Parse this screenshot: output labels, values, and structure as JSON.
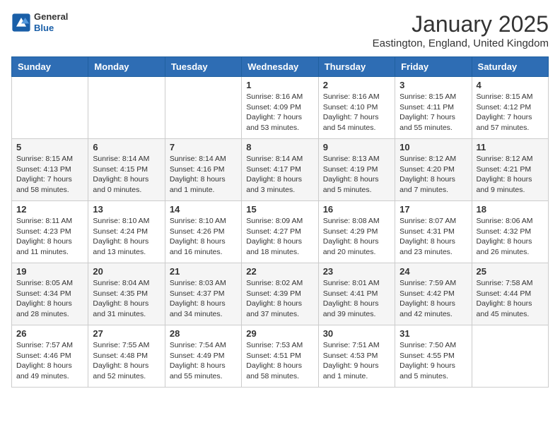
{
  "header": {
    "logo_general": "General",
    "logo_blue": "Blue",
    "month": "January 2025",
    "location": "Eastington, England, United Kingdom"
  },
  "days_of_week": [
    "Sunday",
    "Monday",
    "Tuesday",
    "Wednesday",
    "Thursday",
    "Friday",
    "Saturday"
  ],
  "weeks": [
    [
      {
        "day": "",
        "info": ""
      },
      {
        "day": "",
        "info": ""
      },
      {
        "day": "",
        "info": ""
      },
      {
        "day": "1",
        "info": "Sunrise: 8:16 AM\nSunset: 4:09 PM\nDaylight: 7 hours\nand 53 minutes."
      },
      {
        "day": "2",
        "info": "Sunrise: 8:16 AM\nSunset: 4:10 PM\nDaylight: 7 hours\nand 54 minutes."
      },
      {
        "day": "3",
        "info": "Sunrise: 8:15 AM\nSunset: 4:11 PM\nDaylight: 7 hours\nand 55 minutes."
      },
      {
        "day": "4",
        "info": "Sunrise: 8:15 AM\nSunset: 4:12 PM\nDaylight: 7 hours\nand 57 minutes."
      }
    ],
    [
      {
        "day": "5",
        "info": "Sunrise: 8:15 AM\nSunset: 4:13 PM\nDaylight: 7 hours\nand 58 minutes."
      },
      {
        "day": "6",
        "info": "Sunrise: 8:14 AM\nSunset: 4:15 PM\nDaylight: 8 hours\nand 0 minutes."
      },
      {
        "day": "7",
        "info": "Sunrise: 8:14 AM\nSunset: 4:16 PM\nDaylight: 8 hours\nand 1 minute."
      },
      {
        "day": "8",
        "info": "Sunrise: 8:14 AM\nSunset: 4:17 PM\nDaylight: 8 hours\nand 3 minutes."
      },
      {
        "day": "9",
        "info": "Sunrise: 8:13 AM\nSunset: 4:19 PM\nDaylight: 8 hours\nand 5 minutes."
      },
      {
        "day": "10",
        "info": "Sunrise: 8:12 AM\nSunset: 4:20 PM\nDaylight: 8 hours\nand 7 minutes."
      },
      {
        "day": "11",
        "info": "Sunrise: 8:12 AM\nSunset: 4:21 PM\nDaylight: 8 hours\nand 9 minutes."
      }
    ],
    [
      {
        "day": "12",
        "info": "Sunrise: 8:11 AM\nSunset: 4:23 PM\nDaylight: 8 hours\nand 11 minutes."
      },
      {
        "day": "13",
        "info": "Sunrise: 8:10 AM\nSunset: 4:24 PM\nDaylight: 8 hours\nand 13 minutes."
      },
      {
        "day": "14",
        "info": "Sunrise: 8:10 AM\nSunset: 4:26 PM\nDaylight: 8 hours\nand 16 minutes."
      },
      {
        "day": "15",
        "info": "Sunrise: 8:09 AM\nSunset: 4:27 PM\nDaylight: 8 hours\nand 18 minutes."
      },
      {
        "day": "16",
        "info": "Sunrise: 8:08 AM\nSunset: 4:29 PM\nDaylight: 8 hours\nand 20 minutes."
      },
      {
        "day": "17",
        "info": "Sunrise: 8:07 AM\nSunset: 4:31 PM\nDaylight: 8 hours\nand 23 minutes."
      },
      {
        "day": "18",
        "info": "Sunrise: 8:06 AM\nSunset: 4:32 PM\nDaylight: 8 hours\nand 26 minutes."
      }
    ],
    [
      {
        "day": "19",
        "info": "Sunrise: 8:05 AM\nSunset: 4:34 PM\nDaylight: 8 hours\nand 28 minutes."
      },
      {
        "day": "20",
        "info": "Sunrise: 8:04 AM\nSunset: 4:35 PM\nDaylight: 8 hours\nand 31 minutes."
      },
      {
        "day": "21",
        "info": "Sunrise: 8:03 AM\nSunset: 4:37 PM\nDaylight: 8 hours\nand 34 minutes."
      },
      {
        "day": "22",
        "info": "Sunrise: 8:02 AM\nSunset: 4:39 PM\nDaylight: 8 hours\nand 37 minutes."
      },
      {
        "day": "23",
        "info": "Sunrise: 8:01 AM\nSunset: 4:41 PM\nDaylight: 8 hours\nand 39 minutes."
      },
      {
        "day": "24",
        "info": "Sunrise: 7:59 AM\nSunset: 4:42 PM\nDaylight: 8 hours\nand 42 minutes."
      },
      {
        "day": "25",
        "info": "Sunrise: 7:58 AM\nSunset: 4:44 PM\nDaylight: 8 hours\nand 45 minutes."
      }
    ],
    [
      {
        "day": "26",
        "info": "Sunrise: 7:57 AM\nSunset: 4:46 PM\nDaylight: 8 hours\nand 49 minutes."
      },
      {
        "day": "27",
        "info": "Sunrise: 7:55 AM\nSunset: 4:48 PM\nDaylight: 8 hours\nand 52 minutes."
      },
      {
        "day": "28",
        "info": "Sunrise: 7:54 AM\nSunset: 4:49 PM\nDaylight: 8 hours\nand 55 minutes."
      },
      {
        "day": "29",
        "info": "Sunrise: 7:53 AM\nSunset: 4:51 PM\nDaylight: 8 hours\nand 58 minutes."
      },
      {
        "day": "30",
        "info": "Sunrise: 7:51 AM\nSunset: 4:53 PM\nDaylight: 9 hours\nand 1 minute."
      },
      {
        "day": "31",
        "info": "Sunrise: 7:50 AM\nSunset: 4:55 PM\nDaylight: 9 hours\nand 5 minutes."
      },
      {
        "day": "",
        "info": ""
      }
    ]
  ]
}
